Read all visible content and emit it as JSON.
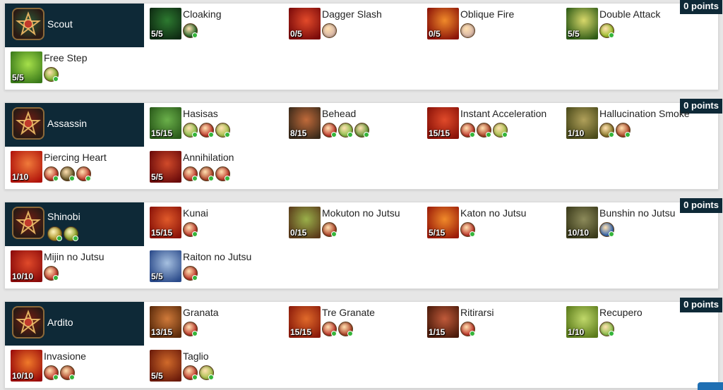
{
  "panels": [
    {
      "class_name": "Scout",
      "points": "0 points",
      "emblem_color": "#2f5d3a",
      "class_subs": [],
      "skills": [
        {
          "name": "Cloaking",
          "count": "5/5",
          "colors": [
            "#0e2a12",
            "#2d7a30"
          ],
          "subs": [
            "#2b6a2d"
          ]
        },
        {
          "name": "Dagger Slash",
          "count": "0/5",
          "colors": [
            "#7a0a0a",
            "#e24a2a"
          ],
          "subs": [
            "#d8b6a6"
          ]
        },
        {
          "name": "Oblique Fire",
          "count": "0/5",
          "colors": [
            "#8a1208",
            "#f08a2a"
          ],
          "subs": [
            "#d8b6a6"
          ]
        },
        {
          "name": "Double Attack",
          "count": "5/5",
          "colors": [
            "#2d5a16",
            "#d8d86a"
          ],
          "subs": [
            "#9cbf2a"
          ]
        },
        {
          "name": "Free Step",
          "count": "5/5",
          "colors": [
            "#3a7a1a",
            "#a6e04a"
          ],
          "subs": [
            "#7ab02a"
          ]
        }
      ]
    },
    {
      "class_name": "Assassin",
      "points": "0 points",
      "emblem_color": "#7a1f14",
      "class_subs": [],
      "skills": [
        {
          "name": "Hasisas",
          "count": "15/15",
          "colors": [
            "#2a5a1a",
            "#6ab04a"
          ],
          "subs": [
            "#8cc04a",
            "#c0392b",
            "#a6c04a"
          ]
        },
        {
          "name": "Behead",
          "count": "8/15",
          "colors": [
            "#3a2a1a",
            "#c06a3a"
          ],
          "subs": [
            "#c0392b",
            "#8cc04a",
            "#6a9a3a"
          ]
        },
        {
          "name": "Instant Acceleration",
          "count": "15/15",
          "colors": [
            "#8a1208",
            "#e04a2a"
          ],
          "subs": [
            "#c0392b",
            "#b0452a",
            "#a6c04a"
          ]
        },
        {
          "name": "Hallucination Smoke",
          "count": "1/10",
          "colors": [
            "#4a4a1a",
            "#b0a05a"
          ],
          "subs": [
            "#8c7a2a",
            "#b04a2a"
          ]
        },
        {
          "name": "Piercing Heart",
          "count": "1/10",
          "colors": [
            "#b0120a",
            "#f07a3a"
          ],
          "subs": [
            "#c0392b",
            "#6a5a2a",
            "#c0392b"
          ]
        },
        {
          "name": "Annihilation",
          "count": "5/5",
          "colors": [
            "#6a0a0a",
            "#d04a2a"
          ],
          "subs": [
            "#c0392b",
            "#b0452a",
            "#c0392b"
          ]
        }
      ]
    },
    {
      "class_name": "Shinobi",
      "points": "0 points",
      "emblem_color": "#7a1f14",
      "class_subs": [
        "#b0962a",
        "#8ca02a"
      ],
      "skills": [
        {
          "name": "Kunai",
          "count": "15/15",
          "colors": [
            "#8a1208",
            "#e05a2a"
          ],
          "subs": [
            "#c0392b"
          ]
        },
        {
          "name": "Mokuton no Jutsu",
          "count": "0/15",
          "colors": [
            "#5a3a1a",
            "#9ab04a"
          ],
          "subs": [
            "#b0452a"
          ]
        },
        {
          "name": "Katon no Jutsu",
          "count": "5/15",
          "colors": [
            "#9a1a08",
            "#f08a2a"
          ],
          "subs": [
            "#c0392b"
          ]
        },
        {
          "name": "Bunshin no Jutsu",
          "count": "10/10",
          "colors": [
            "#3a3a1a",
            "#8c8a5a"
          ],
          "subs": [
            "#3a6ab0"
          ]
        },
        {
          "name": "Mijin no Jutsu",
          "count": "10/10",
          "colors": [
            "#8a0a0a",
            "#e04a2a"
          ],
          "subs": [
            "#c0392b"
          ]
        },
        {
          "name": "Raiton no Jutsu",
          "count": "5/5",
          "colors": [
            "#2a4a8a",
            "#a6c0e0"
          ],
          "subs": [
            "#c0392b"
          ]
        }
      ]
    },
    {
      "class_name": "Ardito",
      "points": "0 points",
      "emblem_color": "#7a1f14",
      "class_subs": [],
      "skills": [
        {
          "name": "Granata",
          "count": "13/15",
          "colors": [
            "#5a2a0a",
            "#d07a3a"
          ],
          "subs": [
            "#c0392b"
          ]
        },
        {
          "name": "Tre Granate",
          "count": "15/15",
          "colors": [
            "#8a1a0a",
            "#e06a2a"
          ],
          "subs": [
            "#c0392b",
            "#b0452a"
          ]
        },
        {
          "name": "Ritirarsi",
          "count": "1/15",
          "colors": [
            "#4a1a0a",
            "#c05a3a"
          ],
          "subs": [
            "#c0392b"
          ]
        },
        {
          "name": "Recupero",
          "count": "1/10",
          "colors": [
            "#5a7a1a",
            "#c0d86a"
          ],
          "subs": [
            "#8cc04a"
          ]
        },
        {
          "name": "Invasione",
          "count": "10/10",
          "colors": [
            "#9a0a0a",
            "#f07a2a"
          ],
          "subs": [
            "#c0392b",
            "#b0452a"
          ]
        },
        {
          "name": "Taglio",
          "count": "5/5",
          "colors": [
            "#6a1a0a",
            "#d06a2a"
          ],
          "subs": [
            "#c0392b",
            "#a6c04a"
          ]
        }
      ]
    }
  ]
}
